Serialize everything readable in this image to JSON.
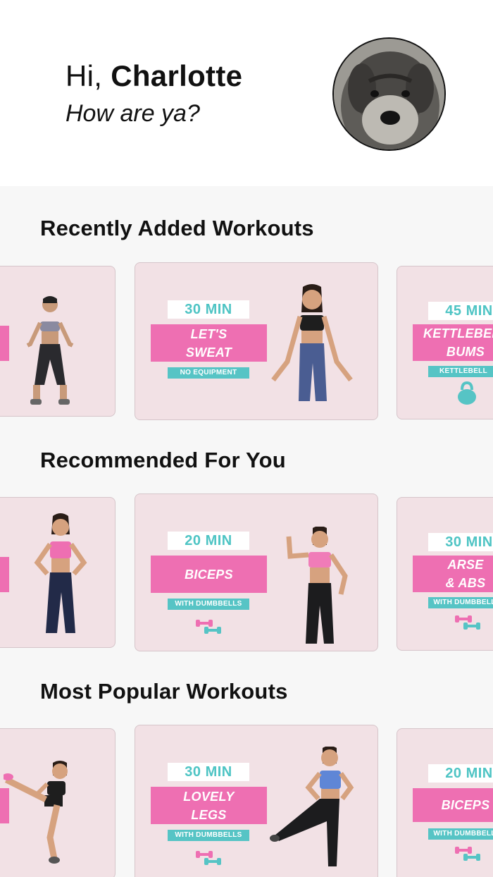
{
  "greeting": {
    "hi": "Hi,",
    "name": "Charlotte",
    "subtitle": "How are ya?"
  },
  "colors": {
    "card_bg": "#f2e1e5",
    "pink": "#ee6fb2",
    "teal": "#56c4c5",
    "page_bg": "#f7f7f7"
  },
  "sections": [
    {
      "title": "Recently Added Workouts",
      "cards": [
        {
          "minutes": "",
          "name": "",
          "tag": ""
        },
        {
          "minutes": "30 MIN",
          "name": "LET'S\nSWEAT",
          "tag": "NO EQUIPMENT",
          "icon": ""
        },
        {
          "minutes": "45 MIN",
          "name": "KETTLEBELL\nBUMS",
          "tag": "KETTLEBELL",
          "icon": "kettlebell-icon"
        }
      ]
    },
    {
      "title": "Recommended For You",
      "cards": [
        {
          "minutes": "",
          "name": "",
          "tag": ""
        },
        {
          "minutes": "20 MIN",
          "name": "BICEPS",
          "tag": "WITH DUMBBELLS",
          "icon": "dumbbells-icon"
        },
        {
          "minutes": "30 MIN",
          "name": "ARSE\n& ABS",
          "tag": "WITH DUMBBELLS",
          "icon": "dumbbells-icon"
        }
      ]
    },
    {
      "title": "Most Popular Workouts",
      "cards": [
        {
          "minutes": "",
          "name": "",
          "tag": ""
        },
        {
          "minutes": "30 MIN",
          "name": "LOVELY\nLEGS",
          "tag": "WITH DUMBBELLS",
          "icon": "dumbbells-icon"
        },
        {
          "minutes": "20 MIN",
          "name": "BICEPS",
          "tag": "WITH DUMBBELLS",
          "icon": "dumbbells-icon"
        }
      ]
    }
  ]
}
